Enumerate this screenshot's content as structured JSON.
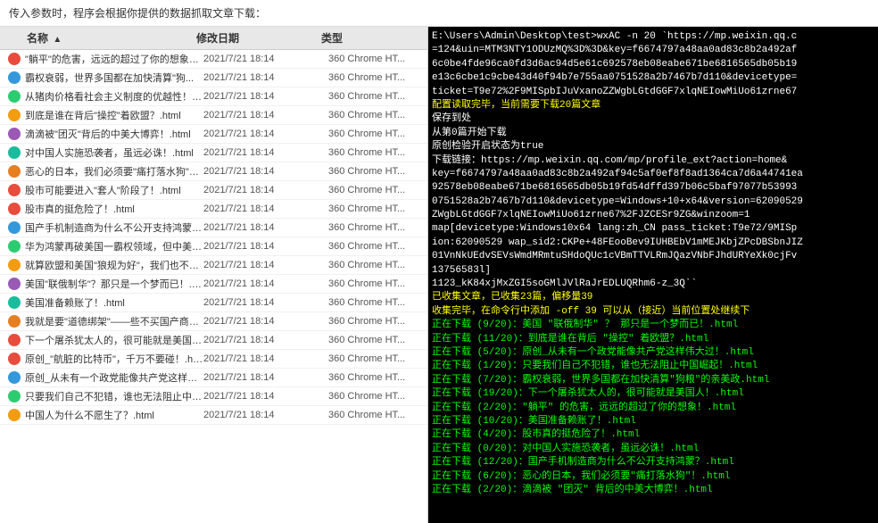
{
  "topBar": {
    "text": "传入参数时，程序会根据你提供的数据抓取文章下载："
  },
  "tableHeaders": {
    "name": "名称",
    "date": "修改日期",
    "type": "类型"
  },
  "files": [
    {
      "name": "\"躺平\"的危害，远远的超过了你的想象！...",
      "date": "2021/7/21 18:14",
      "type": "360 Chrome HT..."
    },
    {
      "name": "霸权衰弱，世界多国都在加快清算\"狗...",
      "date": "2021/7/21 18:14",
      "type": "360 Chrome HT..."
    },
    {
      "name": "从猪肉价格看社会主义制度的优越性！.h...",
      "date": "2021/7/21 18:14",
      "type": "360 Chrome HT..."
    },
    {
      "name": "到底是谁在背后\"操控\"着欧盟？.html",
      "date": "2021/7/21 18:14",
      "type": "360 Chrome HT..."
    },
    {
      "name": "滴滴被\"团灭\"背后的中美大博弈！.html",
      "date": "2021/7/21 18:14",
      "type": "360 Chrome HT..."
    },
    {
      "name": "对中国人实施恐袭者，虽远必诛！.html",
      "date": "2021/7/21 18:14",
      "type": "360 Chrome HT..."
    },
    {
      "name": "恶心的日本，我们必须要\"痛打落水狗\"！...",
      "date": "2021/7/21 18:14",
      "type": "360 Chrome HT..."
    },
    {
      "name": "股市可能要进入\"套人\"阶段了！.html",
      "date": "2021/7/21 18:14",
      "type": "360 Chrome HT..."
    },
    {
      "name": "股市真的挺危险了！.html",
      "date": "2021/7/21 18:14",
      "type": "360 Chrome HT..."
    },
    {
      "name": "国产手机制造商为什么不公开支持鸿蒙？...",
      "date": "2021/7/21 18:14",
      "type": "360 Chrome HT..."
    },
    {
      "name": "华为鸿蒙再破美国一霸权领域，但中美关...",
      "date": "2021/7/21 18:14",
      "type": "360 Chrome HT..."
    },
    {
      "name": "就算欧盟和美国\"狼规为好\"，我们也不怕...",
      "date": "2021/7/21 18:14",
      "type": "360 Chrome HT..."
    },
    {
      "name": "美国\"联俄制华\"？那只是一个梦而已！.h...",
      "date": "2021/7/21 18:14",
      "type": "360 Chrome HT..."
    },
    {
      "name": "美国准备赖账了！.html",
      "date": "2021/7/21 18:14",
      "type": "360 Chrome HT..."
    },
    {
      "name": "我就是要\"道德绑架\"——些不买国产商品的...",
      "date": "2021/7/21 18:14",
      "type": "360 Chrome HT..."
    },
    {
      "name": "下一个屠杀犹太人的，很可能就是美国人...",
      "date": "2021/7/21 18:14",
      "type": "360 Chrome HT..."
    },
    {
      "name": "原创_\"航脏的比特币\"，千万不要碰！.htm...",
      "date": "2021/7/21 18:14",
      "type": "360 Chrome HT..."
    },
    {
      "name": "原创_从未有一个政党能像共产党这样伟...",
      "date": "2021/7/21 18:14",
      "type": "360 Chrome HT..."
    },
    {
      "name": "只要我们自己不犯错，谁也无法阻止中国...",
      "date": "2021/7/21 18:14",
      "type": "360 Chrome HT..."
    },
    {
      "name": "中国人为什么不愿生了？.html",
      "date": "2021/7/21 18:14",
      "type": "360 Chrome HT..."
    }
  ],
  "terminal": {
    "lines": [
      {
        "text": "E:\\Users\\Admin\\Desktop\\test>wxAC -n 20 `https://mp.weixin.qq.c",
        "color": "white"
      },
      {
        "text": "=124&uin=MTM3NTY1ODUzMQ%3D%3D&key=f6674797a48aa0ad83c8b2a492af",
        "color": "white"
      },
      {
        "text": "6c0be4fde96ca0fd3d6ac94d5e61c692578eb08eabe671be6816565db05b19",
        "color": "white"
      },
      {
        "text": "e13c6cbe1c9cbe43d40f94b7e755aa0751528a2b7467b7d110&devicetype=",
        "color": "white"
      },
      {
        "text": "ticket=T9e72%2F9MISpbIJuVxanoZZWgbLGtdGGF7xlqNEIowMiUo61zrne67",
        "color": "white"
      },
      {
        "text": "配置读取完毕，当前需要下载20篇文章",
        "color": "yellow"
      },
      {
        "text": "保存到处",
        "color": "white"
      },
      {
        "text": "从第0篇开始下载",
        "color": "white"
      },
      {
        "text": "原创检验开启状态为true",
        "color": "white"
      },
      {
        "text": "下载链接：https://mp.weixin.qq.com/mp/profile_ext?action=home&",
        "color": "white"
      },
      {
        "text": "key=f6674797a48aa0ad83c8b2a492af94c5af0ef8f8ad1364ca7d6a44741ea",
        "color": "white"
      },
      {
        "text": "92578eb08eabe671be6816565db05b19fd54dffd397b06c5baf97077b53993",
        "color": "white"
      },
      {
        "text": "0751528a2b7467b7d110&devicetype=Windows+10+x64&version=62090529",
        "color": "white"
      },
      {
        "text": "ZWgbLGtdGGF7xlqNEIowMiUo61zrne67%2FJZCESr9ZG&winzoom=1",
        "color": "white"
      },
      {
        "text": "map[devicetype:Windows10x64 lang:zh_CN pass_ticket:T9e72/9MISp",
        "color": "white"
      },
      {
        "text": "ion:62090529 wap_sid2:CKPe+48FEooBev9IUHBEbV1mMEJKbjZPcDBSbnJIZ",
        "color": "white"
      },
      {
        "text": "01VnNkUEdvSEVsWmdMRmtuSHdoQUc1cVBmTTVLRmJQazVNbFJhdURYeXk0cjFv",
        "color": "white"
      },
      {
        "text": "13756583l]",
        "color": "white"
      },
      {
        "text": "1123_kK84xjMxZGI5soGMlJVlRaJrEDLUQRhm6-z_3Q``",
        "color": "white"
      },
      {
        "text": "已收集文章，已收集23篇，偏移量39",
        "color": "yellow"
      },
      {
        "text": "收集完毕，在命令行中添加 -off 39 可以从（接近）当前位置处继续下",
        "color": "yellow"
      },
      {
        "text": "正在下载 (9/20)：美国 \"联俄制华\" ？ 那只是一个梦而已！.html",
        "color": "green"
      },
      {
        "text": "正在下载 (11/20)：到底是谁在背后 \"操控\" 着欧盟？.html",
        "color": "green"
      },
      {
        "text": "正在下载 (5/20)：原创_从未有一个政党能像共产党这样伟大过！.html",
        "color": "green"
      },
      {
        "text": "正在下载 (1/20)：只要我们自己不犯错，谁也无法阻止中国崛起！.html",
        "color": "green"
      },
      {
        "text": "正在下载 (7/20)：霸权衰弱，世界多国都在加快清算\"狗粮\"的亲美政.html",
        "color": "green"
      },
      {
        "text": "正在下载 (19/20)：下一个屠杀犹太人的，很可能就是美国人！.html",
        "color": "green"
      },
      {
        "text": "正在下载 (2/20)：\"躺平\" 的危害，远远的超过了你的想象！.html",
        "color": "green"
      },
      {
        "text": "正在下载 (10/20)：美国准备赖账了！.html",
        "color": "green"
      },
      {
        "text": "正在下载 (4/20)：股市真的挺危险了！.html",
        "color": "green"
      },
      {
        "text": "正在下载 (0/20)：对中国人实施恐袭者，虽远必诛！.html",
        "color": "green"
      },
      {
        "text": "正在下载 (12/20)：国产手机制造商为什么不公开支持鸿蒙？.html",
        "color": "green"
      },
      {
        "text": "正在下载 (6/20)：恶心的日本，我们必须要\"痛打落水狗\"！.html",
        "color": "green"
      },
      {
        "text": "正在下载 (2/20)：滴滴被 \"团灭\" 背后的中美大博弈！.html",
        "color": "green"
      }
    ]
  }
}
